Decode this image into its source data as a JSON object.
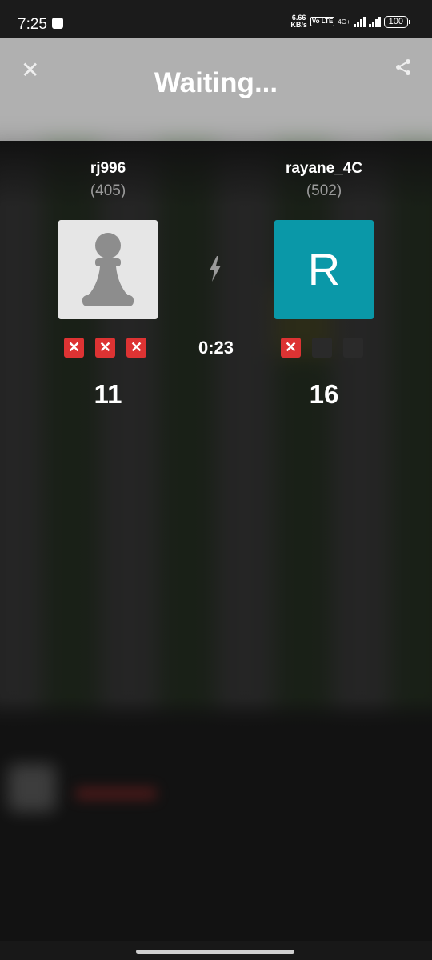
{
  "status_bar": {
    "time": "7:25",
    "speed": "6.66",
    "speed_unit": "KB/s",
    "volte": "Vo LTE",
    "network": "4G+",
    "battery": "100"
  },
  "header": {
    "title": "Waiting...",
    "close_icon": "close-icon",
    "share_icon": "share-icon",
    "background": "#b0b0b0"
  },
  "match": {
    "timer": "0:23",
    "bolt_icon": "lightning-bolt-icon",
    "players": [
      {
        "name": "rj996",
        "rating": "(405)",
        "avatar": "pawn",
        "marks": [
          "x",
          "x",
          "x"
        ],
        "score": "11"
      },
      {
        "name": "rayane_4C",
        "rating": "(502)",
        "avatar": "R",
        "avatar_color": "#0a98a8",
        "marks": [
          "x",
          "empty",
          "empty"
        ],
        "score": "16"
      }
    ]
  },
  "colors": {
    "mark_x": "#dd3333",
    "mark_empty": "#2a2a2a"
  }
}
